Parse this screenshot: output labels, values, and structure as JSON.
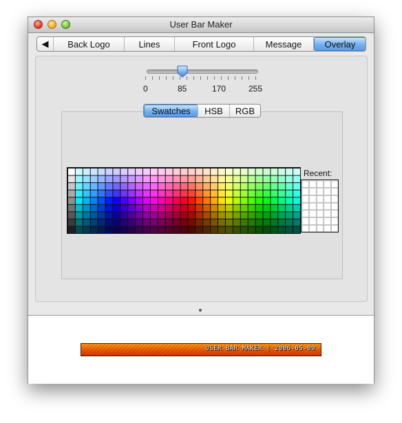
{
  "window": {
    "title": "User Bar Maker"
  },
  "tabs": {
    "back_arrow": "◀",
    "items": [
      "Back Logo",
      "Lines",
      "Front Logo",
      "Message",
      "Overlay"
    ],
    "selected": "Overlay"
  },
  "slider": {
    "value": 85,
    "min": 0,
    "max": 255,
    "ticks": [
      "0",
      "85",
      "170",
      "255"
    ]
  },
  "color_chooser": {
    "tabs": [
      "Swatches",
      "HSB",
      "RGB"
    ],
    "selected": "Swatches",
    "recent_label": "Recent:"
  },
  "preview": {
    "userbar_text": "USER BAR MAKER | 2006-05-09"
  },
  "colors": {
    "accent": "#5a9fe6",
    "userbar_top": "#ff9a1a",
    "userbar_bottom": "#d83a00"
  }
}
